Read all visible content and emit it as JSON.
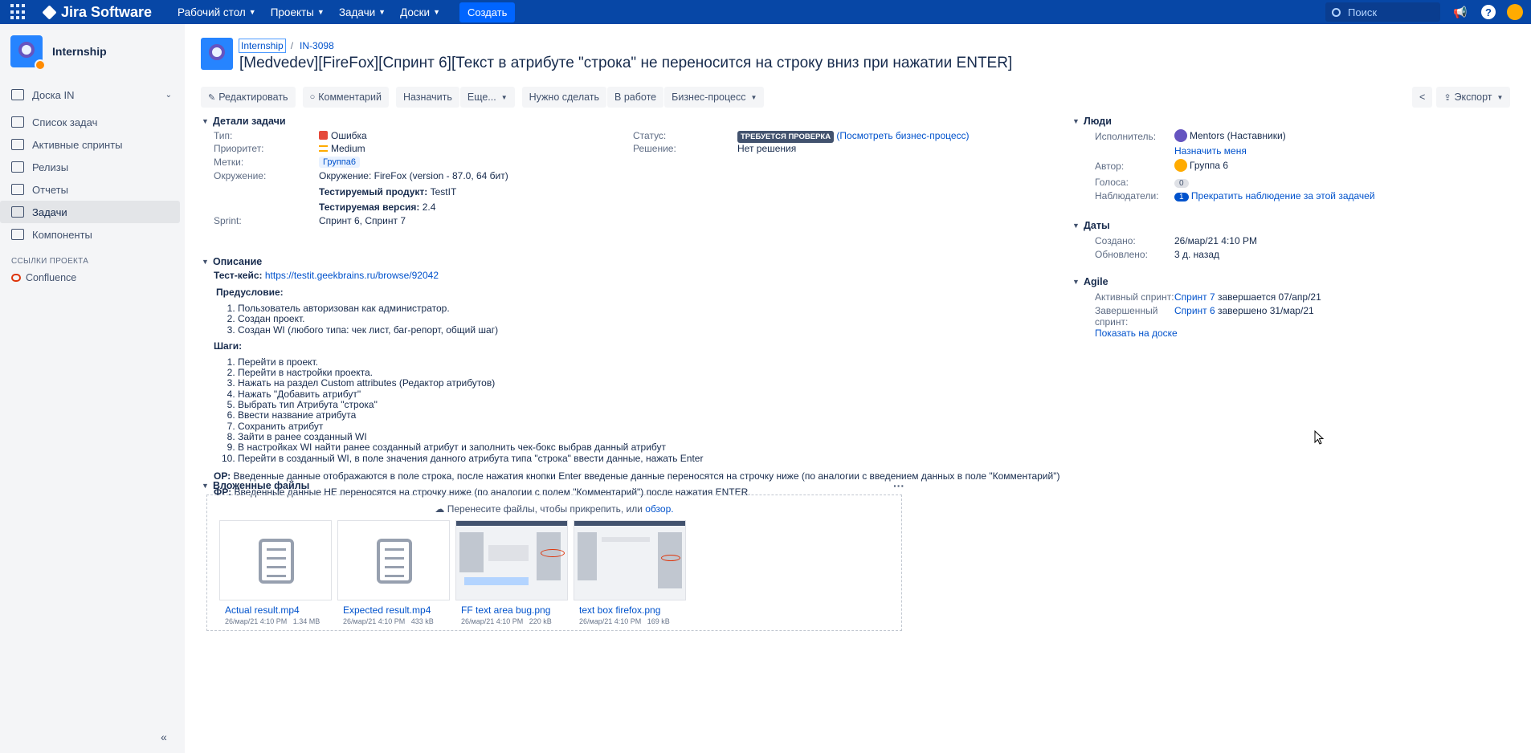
{
  "topnav": {
    "logo": "Jira Software",
    "menu": [
      "Рабочий стол",
      "Проекты",
      "Задачи",
      "Доски"
    ],
    "create": "Создать",
    "search_placeholder": "Поиск"
  },
  "sidebar": {
    "project": "Internship",
    "items": [
      {
        "label": "Доска IN",
        "icon": "board-icon"
      },
      {
        "label": "Список задач",
        "icon": "backlog-icon"
      },
      {
        "label": "Активные спринты",
        "icon": "sprint-icon"
      },
      {
        "label": "Релизы",
        "icon": "release-icon"
      },
      {
        "label": "Отчеты",
        "icon": "report-icon"
      },
      {
        "label": "Задачи",
        "icon": "issues-icon"
      },
      {
        "label": "Компоненты",
        "icon": "components-icon"
      }
    ],
    "section": "ССЫЛКИ ПРОЕКТА",
    "confluence": "Confluence"
  },
  "issue": {
    "project": "Internship",
    "key": "IN-3098",
    "title": "[Medvedev][FireFox][Спринт 6][Текст в атрибуте \"строка\" не переносится на строку вниз при нажатии ENTER]"
  },
  "toolbar": {
    "edit": "Редактировать",
    "comment": "Комментарий",
    "assign": "Назначить",
    "more": "Еще...",
    "todo": "Нужно сделать",
    "inprogress": "В работе",
    "workflow": "Бизнес-процесс",
    "export": "Экспорт"
  },
  "details": {
    "heading": "Детали задачи",
    "type_label": "Тип:",
    "type": "Ошибка",
    "priority_label": "Приоритет:",
    "priority": "Medium",
    "labels_label": "Метки:",
    "labels": "Группа6",
    "env_label": "Окружение:",
    "env": "Окружение: FireFox (version - 87.0, 64 бит)",
    "product_label": "Тестируемый продукт:",
    "product": "TestIT",
    "version_label": "Тестируемая версия:",
    "version": "2.4",
    "sprint_label": "Sprint:",
    "sprint": "Спринт 6, Спринт 7",
    "status_label": "Статус:",
    "status": "ТРЕБУЕТСЯ ПРОВЕРКА",
    "status_link": "(Посмотреть бизнес-процесс)",
    "resolution_label": "Решение:",
    "resolution": "Нет решения"
  },
  "description": {
    "heading": "Описание",
    "testcase_label": "Тест-кейс:",
    "testcase_link": "https://testit.geekbrains.ru/browse/92042",
    "precondition_label": "Предусловие:",
    "preconditions": [
      "Пользователь авторизован как администратор.",
      "Создан проект.",
      "Создан WI (любого типа: чек лист, баг-репорт, общий шаг)"
    ],
    "steps_label": "Шаги:",
    "steps": [
      "Перейти в проект.",
      "Перейти в настройки проекта.",
      "Нажать на раздел Custom attributes (Редактор атрибутов)",
      "Нажать \"Добавить атрибут\"",
      "Выбрать тип Атрибута \"строка\"",
      "Ввести название атрибута",
      "Сохранить атрибут",
      "Зайти в ранее созданный WI",
      "В настройках WI найти ранее созданный атрибут и заполнить чек-бокс выбрав данный атрибут",
      "Перейти в созданный WI,  в поле значения данного атрибута типа \"строка\" ввести данные, нажать Enter"
    ],
    "expected_label": "ОР:",
    "expected": "Введенные данные отображаются в поле строка, после нажатия кнопки Enter введеные данные переносятся на строчку ниже (по аналогии с введением данных в поле \"Комментарий\")",
    "actual_label": "ФР:",
    "actual": "Введенные данные НЕ переносятся на строчку ниже (по аналогии с полем \"Комментарий\") после нажатия ENTER."
  },
  "attachments": {
    "heading": "Вложенные файлы",
    "drop_text": "Перенесите файлы, чтобы прикрепить, или",
    "drop_link": "обзор.",
    "files": [
      {
        "name": "Actual result.mp4",
        "date": "26/мар/21 4:10 PM",
        "size": "1.34 MB"
      },
      {
        "name": "Expected result.mp4",
        "date": "26/мар/21 4:10 PM",
        "size": "433 kB"
      },
      {
        "name": "FF text area bug.png",
        "date": "26/мар/21 4:10 PM",
        "size": "220 kB"
      },
      {
        "name": "text box firefox.png",
        "date": "26/мар/21 4:10 PM",
        "size": "169 kB"
      }
    ]
  },
  "people": {
    "heading": "Люди",
    "assignee_label": "Исполнитель:",
    "assignee": "Mentors (Наставники)",
    "assign_me": "Назначить меня",
    "reporter_label": "Автор:",
    "reporter": "Группа 6",
    "votes_label": "Голоса:",
    "votes": "0",
    "watchers_label": "Наблюдатели:",
    "watchers": "1",
    "watch_link": "Прекратить наблюдение за этой задачей"
  },
  "dates": {
    "heading": "Даты",
    "created_label": "Создано:",
    "created": "26/мар/21 4:10 PM",
    "updated_label": "Обновлено:",
    "updated": "3 д. назад"
  },
  "agile": {
    "heading": "Agile",
    "active_label": "Активный спринт:",
    "active_link": "Спринт 7",
    "active_rest": " завершается 07/апр/21",
    "done_label_1": "Завершенный",
    "done_label_2": "спринт:",
    "done_link": "Спринт 6",
    "done_rest": " завершено 31/мар/21",
    "board_link": "Показать на доске"
  }
}
